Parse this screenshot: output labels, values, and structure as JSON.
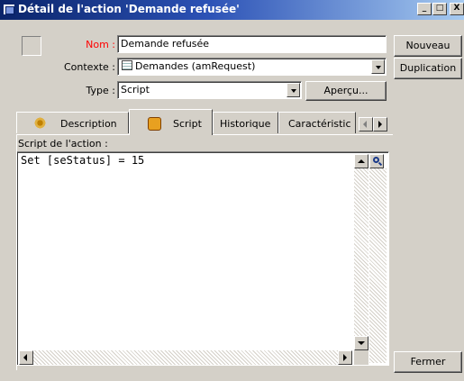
{
  "window": {
    "title": "Détail de l'action 'Demande refusée'",
    "minimize": "_",
    "maximize": "□",
    "close": "X"
  },
  "form": {
    "name_label": "Nom :",
    "name_value": "Demande refusée",
    "context_label": "Contexte :",
    "context_value": "Demandes (amRequest)",
    "type_label": "Type :",
    "type_value": "Script",
    "preview_button": "Aperçu..."
  },
  "side_buttons": {
    "new": "Nouveau",
    "duplicate": "Duplication",
    "close": "Fermer"
  },
  "tabs": [
    {
      "label": "Description",
      "icon": "gears-icon",
      "active": false
    },
    {
      "label": "Script",
      "icon": "script-icon",
      "active": true
    },
    {
      "label": "Historique",
      "active": false
    },
    {
      "label": "Caractéristic",
      "active": false
    }
  ],
  "script_panel": {
    "label": "Script de l'action :",
    "code": "Set [seStatus] = 15"
  },
  "colors": {
    "title_gradient_start": "#0a246a",
    "title_gradient_end": "#a6caf0",
    "name_label_color": "#ff0000",
    "dialog_face": "#d4d0c8"
  }
}
